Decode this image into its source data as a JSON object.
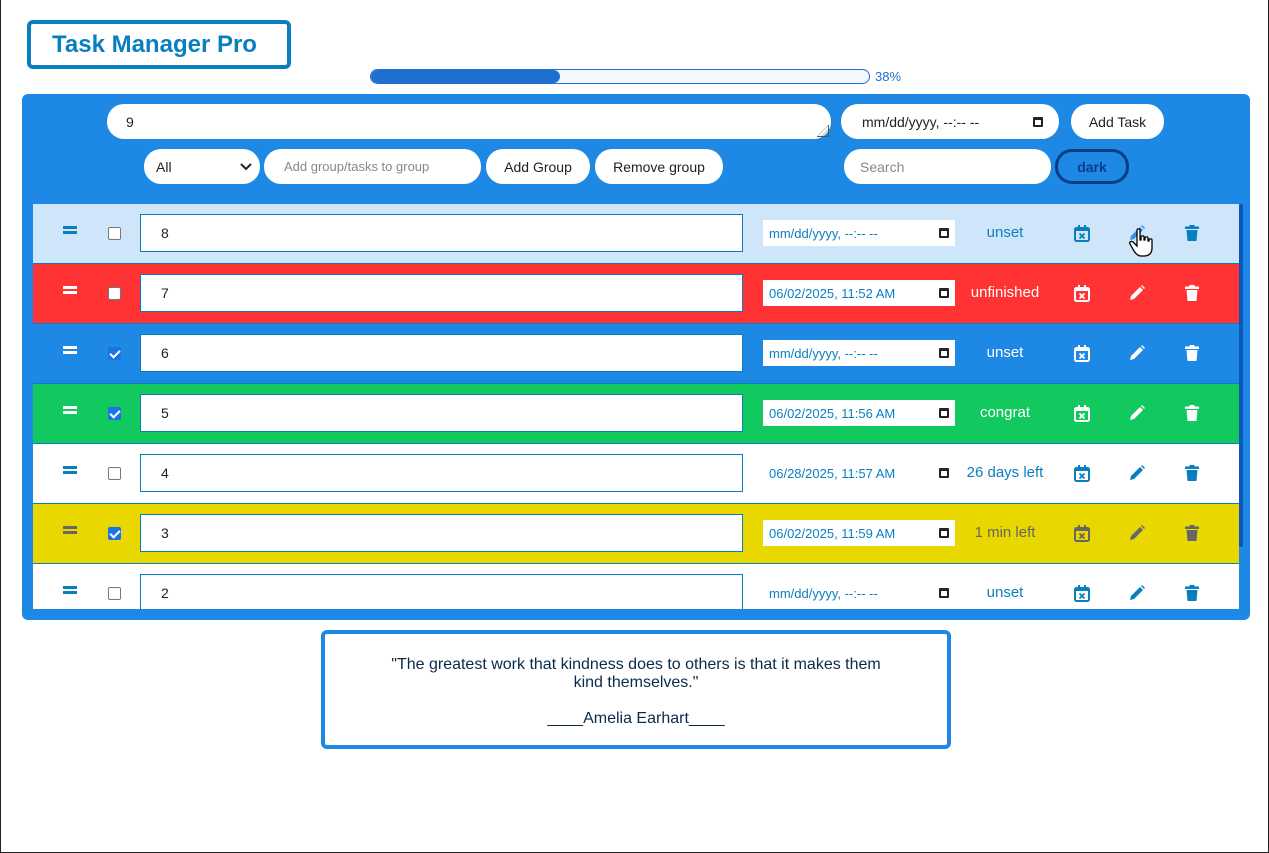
{
  "app": {
    "title": "Task Manager Pro"
  },
  "progress": {
    "percent": 38,
    "label": "38%"
  },
  "toolbar": {
    "task_input_value": "9",
    "datetime_placeholder": "mm/dd/yyyy, --:-- --",
    "add_task_label": "Add Task",
    "group_select_value": "All",
    "group_input_placeholder": "Add group/tasks to group",
    "add_group_label": "Add Group",
    "remove_group_label": "Remove group",
    "search_placeholder": "Search",
    "theme_button_label": "dark"
  },
  "colors": {
    "unset_bg": "#1e88e5",
    "unfinished_bg": "#ff3333",
    "congrat_bg": "#12c95f",
    "pending_bg": "#ffffff",
    "warning_bg": "#e8d800",
    "hover_bg": "#cfe5f9",
    "accent": "#0a7fc0"
  },
  "tasks": [
    {
      "name": "8",
      "datetime": "mm/dd/yyyy, --:-- --",
      "status": "unset",
      "checked": false,
      "bg": "#cfe5f9",
      "fg": "#0a7fc0"
    },
    {
      "name": "7",
      "datetime": "06/02/2025, 11:52 AM",
      "status": "unfinished",
      "checked": false,
      "bg": "#ff3333",
      "fg": "#ffffff"
    },
    {
      "name": "6",
      "datetime": "mm/dd/yyyy, --:-- --",
      "status": "unset",
      "checked": true,
      "bg": "#1e88e5",
      "fg": "#ffffff"
    },
    {
      "name": "5",
      "datetime": "06/02/2025, 11:56 AM",
      "status": "congrat",
      "checked": true,
      "bg": "#12c95f",
      "fg": "#ffffff"
    },
    {
      "name": "4",
      "datetime": "06/28/2025, 11:57 AM",
      "status": "26 days left",
      "checked": false,
      "bg": "#ffffff",
      "fg": "#0a7fc0"
    },
    {
      "name": "3",
      "datetime": "06/02/2025, 11:59 AM",
      "status": "1 min left",
      "checked": true,
      "bg": "#e8d800",
      "fg": "#666666"
    },
    {
      "name": "2",
      "datetime": "mm/dd/yyyy, --:-- --",
      "status": "unset",
      "checked": false,
      "bg": "#ffffff",
      "fg": "#0a7fc0"
    }
  ],
  "quote": {
    "text": "\"The greatest work that kindness does to others is that it makes them kind themselves.\"",
    "author": "____Amelia Earhart____"
  }
}
